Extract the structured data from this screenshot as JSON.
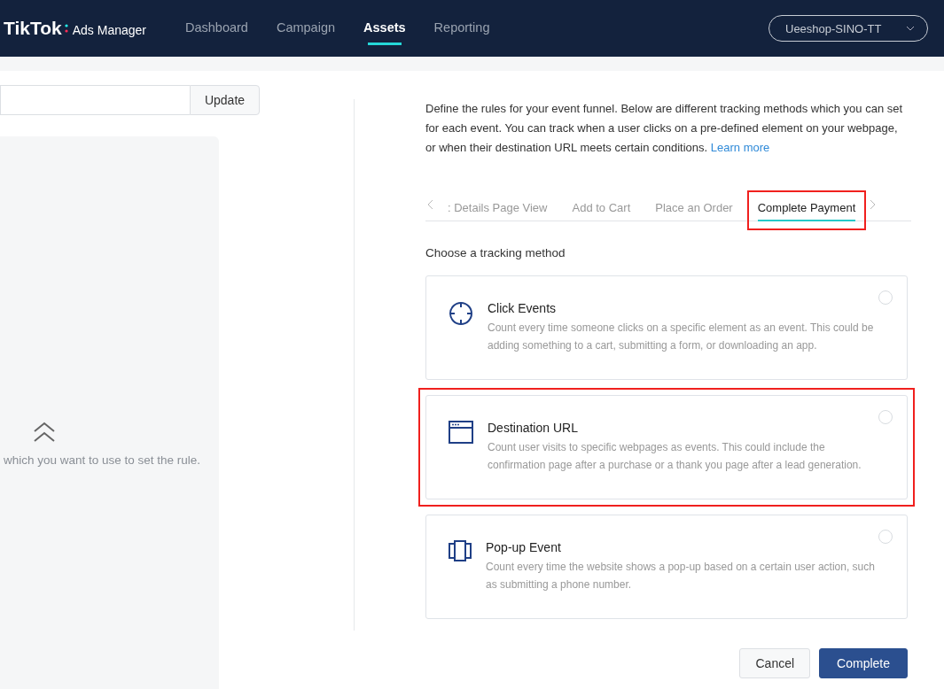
{
  "header": {
    "logo": "TikTok",
    "product": "Ads Manager",
    "nav": [
      {
        "label": "Dashboard",
        "selected": false
      },
      {
        "label": "Campaign",
        "selected": false
      },
      {
        "label": "Assets",
        "selected": true
      },
      {
        "label": "Reporting",
        "selected": false
      }
    ],
    "account": "Ueeshop-SINO-TT"
  },
  "left": {
    "button": "Update",
    "hint": "which you want to use to set the rule."
  },
  "right": {
    "intro": "Define the rules for your event funnel. Below are different tracking methods which you can set for each event. You can track when a user clicks on a pre-defined element on your webpage, or when their destination URL meets certain conditions.",
    "learn_more": "Learn more",
    "tabs": [
      {
        "label": ": Details Page View",
        "selected": false,
        "annotated": false
      },
      {
        "label": "Add to Cart",
        "selected": false,
        "annotated": false
      },
      {
        "label": "Place an Order",
        "selected": false,
        "annotated": false
      },
      {
        "label": "Complete Payment",
        "selected": true,
        "annotated": true
      }
    ],
    "method_label": "Choose a tracking method",
    "methods": [
      {
        "kind": "click",
        "title": "Click Events",
        "description": "Count every time someone clicks on a specific element as an event. This could be adding something to a cart, submitting a form, or downloading an app.",
        "selected": false,
        "annotated": false
      },
      {
        "kind": "url",
        "title": "Destination URL",
        "description": "Count user visits to specific webpages as events. This could include the confirmation page after a purchase or a thank you page after a lead generation.",
        "selected": false,
        "annotated": true
      },
      {
        "kind": "popup",
        "title": "Pop-up Event",
        "description": "Count every time the website shows a pop-up based on a certain user action, such as submitting a phone number.",
        "selected": false,
        "annotated": false
      }
    ],
    "buttons": [
      {
        "kind": "secondary",
        "label": "Cancel"
      },
      {
        "kind": "primary",
        "label": "Complete"
      }
    ]
  }
}
